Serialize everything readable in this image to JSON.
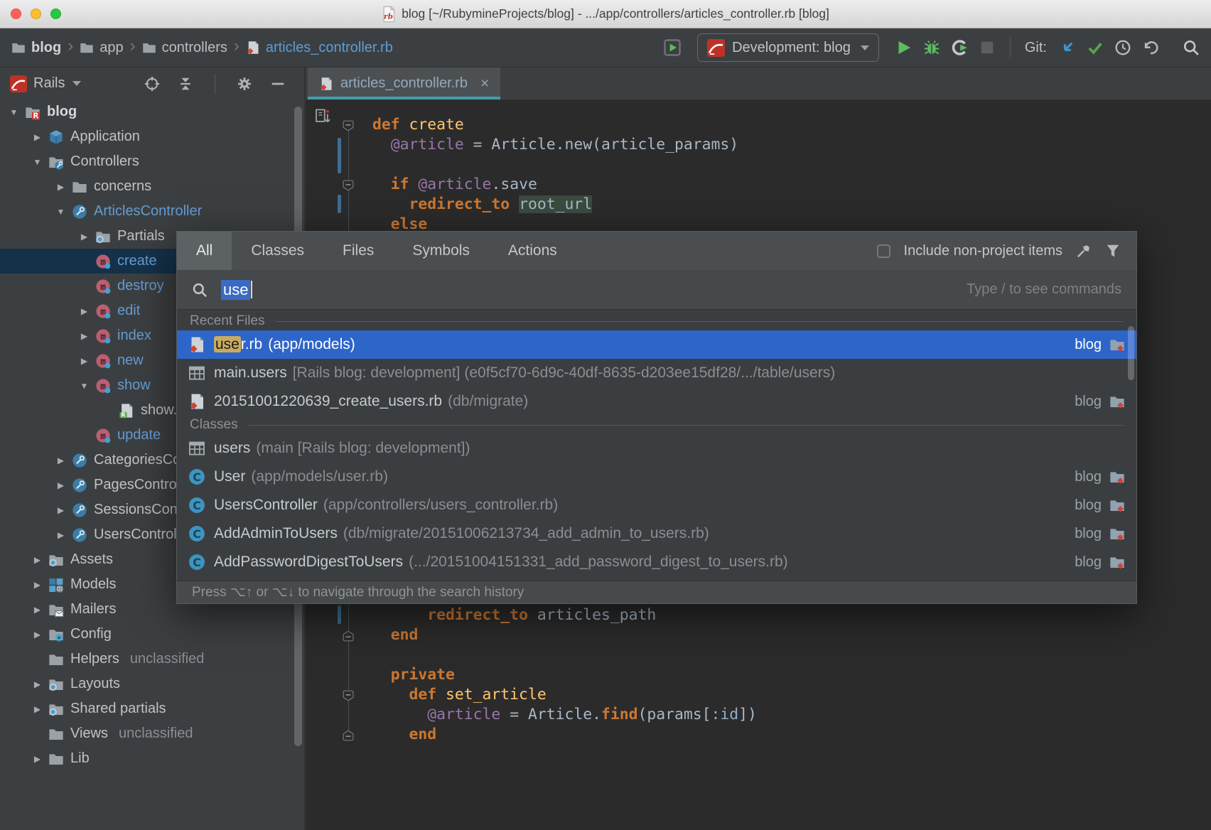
{
  "window": {
    "title": "blog [~/RubymineProjects/blog] - .../app/controllers/articles_controller.rb [blog]"
  },
  "toolbar": {
    "breadcrumbs": [
      {
        "label": "blog",
        "icon": "folder",
        "bold": true
      },
      {
        "label": "app",
        "icon": "folder"
      },
      {
        "label": "controllers",
        "icon": "folder"
      },
      {
        "label": "articles_controller.rb",
        "icon": "ruby-file",
        "accent": true
      }
    ],
    "run_config": {
      "label": "Development: blog",
      "icon": "rails"
    },
    "run_actions": [
      "run",
      "debug",
      "run-with-coverage",
      "stop"
    ],
    "git_label": "Git:",
    "git_actions": [
      "update-project",
      "commit",
      "history",
      "rollback"
    ],
    "search_action": "search-everywhere"
  },
  "sidebar": {
    "header": {
      "title": "Rails",
      "actions": [
        "locate",
        "collapse-all",
        "settings",
        "hide"
      ]
    },
    "tree": [
      {
        "lvl": 0,
        "arrow": "open",
        "icon": "folder-rails",
        "label": "blog",
        "bold": true
      },
      {
        "lvl": 1,
        "arrow": "closed",
        "icon": "cube",
        "label": "Application"
      },
      {
        "lvl": 1,
        "arrow": "open",
        "icon": "folder-controllers",
        "label": "Controllers"
      },
      {
        "lvl": 2,
        "arrow": "closed",
        "icon": "folder",
        "label": "concerns"
      },
      {
        "lvl": 2,
        "arrow": "open",
        "icon": "controller",
        "label": "ArticlesController",
        "blue": true
      },
      {
        "lvl": 3,
        "arrow": "closed",
        "icon": "folder-views",
        "label": "Partials"
      },
      {
        "lvl": 3,
        "arrow": null,
        "icon": "method",
        "label": "create",
        "blue": true,
        "selected": true
      },
      {
        "lvl": 3,
        "arrow": null,
        "icon": "method",
        "label": "destroy",
        "blue": true
      },
      {
        "lvl": 3,
        "arrow": "closed",
        "icon": "method",
        "label": "edit",
        "blue": true
      },
      {
        "lvl": 3,
        "arrow": "closed",
        "icon": "method",
        "label": "index",
        "blue": true
      },
      {
        "lvl": 3,
        "arrow": "closed",
        "icon": "method",
        "label": "new",
        "blue": true
      },
      {
        "lvl": 3,
        "arrow": "open",
        "icon": "method",
        "label": "show",
        "blue": true
      },
      {
        "lvl": 4,
        "arrow": null,
        "icon": "ruby-view",
        "label": "show.html.erb"
      },
      {
        "lvl": 3,
        "arrow": null,
        "icon": "method",
        "label": "update",
        "blue": true
      },
      {
        "lvl": 2,
        "arrow": "closed",
        "icon": "controller",
        "label": "CategoriesController"
      },
      {
        "lvl": 2,
        "arrow": "closed",
        "icon": "controller",
        "label": "PagesController"
      },
      {
        "lvl": 2,
        "arrow": "closed",
        "icon": "controller",
        "label": "SessionsController"
      },
      {
        "lvl": 2,
        "arrow": "closed",
        "icon": "controller",
        "label": "UsersController"
      },
      {
        "lvl": 1,
        "arrow": "closed",
        "icon": "folder-views",
        "label": "Assets"
      },
      {
        "lvl": 1,
        "arrow": "closed",
        "icon": "models",
        "label": "Models"
      },
      {
        "lvl": 1,
        "arrow": "closed",
        "icon": "folder-mailers",
        "label": "Mailers"
      },
      {
        "lvl": 1,
        "arrow": "closed",
        "icon": "folder-config",
        "label": "Config"
      },
      {
        "lvl": 1,
        "arrow": null,
        "icon": "folder",
        "label": "Helpers",
        "suffix": "unclassified"
      },
      {
        "lvl": 1,
        "arrow": "closed",
        "icon": "folder-views",
        "label": "Layouts"
      },
      {
        "lvl": 1,
        "arrow": "closed",
        "icon": "folder-views",
        "label": "Shared partials"
      },
      {
        "lvl": 1,
        "arrow": null,
        "icon": "folder",
        "label": "Views",
        "suffix": "unclassified"
      },
      {
        "lvl": 1,
        "arrow": "closed",
        "icon": "folder",
        "label": "Lib"
      }
    ]
  },
  "editor": {
    "tab": {
      "label": "articles_controller.rb",
      "icon": "ruby-file",
      "close": "×"
    },
    "code_top": [
      [
        [
          "def ",
          "k"
        ],
        [
          "create",
          "m"
        ]
      ],
      [
        [
          "  ",
          "p"
        ],
        [
          "@article",
          "iv"
        ],
        [
          " = Article.new(article_params)",
          "p"
        ]
      ],
      [],
      [
        [
          "  ",
          "p"
        ],
        [
          "if ",
          "k"
        ],
        [
          "@article",
          "iv"
        ],
        [
          ".save",
          "p"
        ]
      ],
      [
        [
          "    ",
          "p"
        ],
        [
          "redirect_to ",
          "rm"
        ],
        [
          "root_url",
          "hl"
        ]
      ],
      [
        [
          "  ",
          "p"
        ],
        [
          "else",
          "k"
        ]
      ]
    ],
    "code_bottom": [
      [
        [
          "      ",
          "p"
        ],
        [
          "redirect_to ",
          "rm"
        ],
        [
          "articles_path",
          "p"
        ]
      ],
      [
        [
          "  ",
          "p"
        ],
        [
          "end",
          "k"
        ]
      ],
      [],
      [
        [
          "  ",
          "p"
        ],
        [
          "private",
          "k"
        ]
      ],
      [
        [
          "    ",
          "p"
        ],
        [
          "def ",
          "k"
        ],
        [
          "set_article",
          "m"
        ]
      ],
      [
        [
          "      ",
          "p"
        ],
        [
          "@article",
          "iv"
        ],
        [
          " = Article.",
          "p"
        ],
        [
          "find",
          "rm"
        ],
        [
          "(params[",
          "p"
        ],
        [
          ":id",
          "sym"
        ],
        [
          "])",
          "p"
        ]
      ],
      [
        [
          "    ",
          "p"
        ],
        [
          "end",
          "k"
        ]
      ]
    ]
  },
  "popup": {
    "tabs": [
      {
        "label": "All",
        "selected": true
      },
      {
        "label": "Classes"
      },
      {
        "label": "Files"
      },
      {
        "label": "Symbols"
      },
      {
        "label": "Actions"
      }
    ],
    "include_label": "Include non-project items",
    "header_icons": [
      "pin",
      "filter"
    ],
    "search": {
      "value": "use",
      "hint": "Type / to see commands"
    },
    "results": [
      {
        "type": "section",
        "label": "Recent Files"
      },
      {
        "type": "item",
        "icon": "ruby-file",
        "match": "use",
        "name": "r.rb",
        "location": "(app/models)",
        "right": "blog",
        "right_icon": "module-folder",
        "selected": true
      },
      {
        "type": "item",
        "icon": "table",
        "name": "main.users",
        "location": "[Rails blog: development] (e0f5cf70-6d9c-40df-8635-d203ee15df28/.../table/users)"
      },
      {
        "type": "item",
        "icon": "ruby-file",
        "name": "20151001220639_create_users.rb",
        "location": "(db/migrate)",
        "right": "blog",
        "right_icon": "module-folder"
      },
      {
        "type": "section",
        "label": "Classes"
      },
      {
        "type": "item",
        "icon": "table",
        "name": "users",
        "location": "(main [Rails blog: development])"
      },
      {
        "type": "item",
        "icon": "class",
        "name": "User",
        "location": "(app/models/user.rb)",
        "right": "blog",
        "right_icon": "module-folder"
      },
      {
        "type": "item",
        "icon": "class",
        "name": "UsersController",
        "location": "(app/controllers/users_controller.rb)",
        "right": "blog",
        "right_icon": "module-folder"
      },
      {
        "type": "item",
        "icon": "class",
        "name": "AddAdminToUsers",
        "location": "(db/migrate/20151006213734_add_admin_to_users.rb)",
        "right": "blog",
        "right_icon": "module-folder"
      },
      {
        "type": "item",
        "icon": "class",
        "name": "AddPasswordDigestToUsers",
        "location": "(.../20151004151331_add_password_digest_to_users.rb)",
        "right": "blog",
        "right_icon": "module-folder"
      }
    ],
    "footer_hint": "Press ⌥↑ or ⌥↓ to navigate through the search history"
  },
  "colors": {
    "traffic_close": "#FF5F57",
    "traffic_minimize": "#FEBC2E",
    "traffic_zoom": "#28C840",
    "selection_blue": "#2E65C9",
    "tree_selection": "#15314A",
    "match_highlight": "#C9AB5F",
    "tab_underline": "#3F9EAD",
    "keyword_orange": "#CC7832",
    "method_yellow": "#FFC66D",
    "ivar_purple": "#9876AA",
    "code_plain": "#A9B7C6",
    "link_blue": "#5C9CD8",
    "run_green": "#5DBB63",
    "panel_bg": "#3C3F41",
    "editor_bg": "#2B2B2B"
  }
}
